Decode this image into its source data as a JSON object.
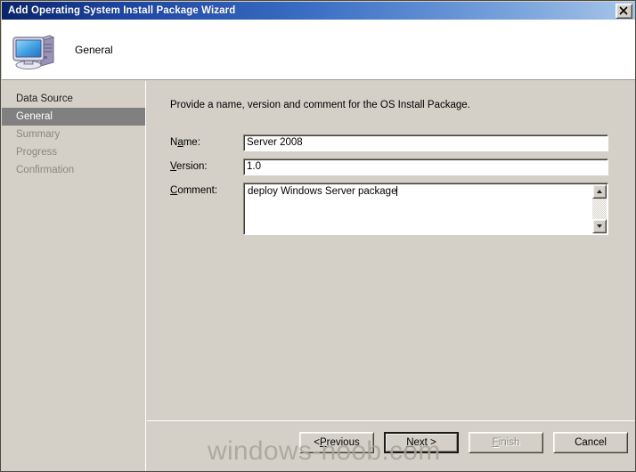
{
  "window": {
    "title": "Add Operating System Install Package Wizard",
    "close_label": "x"
  },
  "header": {
    "title": "General",
    "icon": "computer-icon"
  },
  "sidebar": {
    "items": [
      {
        "label": "Data Source",
        "state": "done"
      },
      {
        "label": "General",
        "state": "active"
      },
      {
        "label": "Summary",
        "state": "pending"
      },
      {
        "label": "Progress",
        "state": "pending"
      },
      {
        "label": "Confirmation",
        "state": "pending"
      }
    ]
  },
  "main": {
    "intro": "Provide a name, version and comment for the OS Install Package.",
    "fields": {
      "name": {
        "label_pre": "N",
        "label_mnemonic": "a",
        "label_post": "me:",
        "value": "Server 2008"
      },
      "version": {
        "label_pre": "",
        "label_mnemonic": "V",
        "label_post": "ersion:",
        "value": "1.0"
      },
      "comment": {
        "label_pre": "",
        "label_mnemonic": "C",
        "label_post": "omment:",
        "value": "deploy Windows Server package"
      }
    }
  },
  "footer": {
    "buttons": [
      {
        "pre": "< ",
        "mnemonic": "P",
        "post": "revious",
        "state": "enabled",
        "name": "previous-button"
      },
      {
        "pre": "",
        "mnemonic": "N",
        "post": "ext >",
        "state": "default",
        "name": "next-button"
      },
      {
        "pre": "",
        "mnemonic": "F",
        "post": "inish",
        "state": "disabled",
        "name": "finish-button"
      },
      {
        "pre": "",
        "mnemonic": "",
        "post": "Cancel",
        "state": "enabled",
        "name": "cancel-button"
      }
    ]
  },
  "watermark": {
    "text": "windows-noob.com"
  },
  "colors": {
    "title_bar_dark": "#0a246a",
    "title_bar_light": "#a8c6e8",
    "dialog_face": "#d4d0c8",
    "active_nav": "#808080",
    "header_bg": "#ffffff"
  }
}
